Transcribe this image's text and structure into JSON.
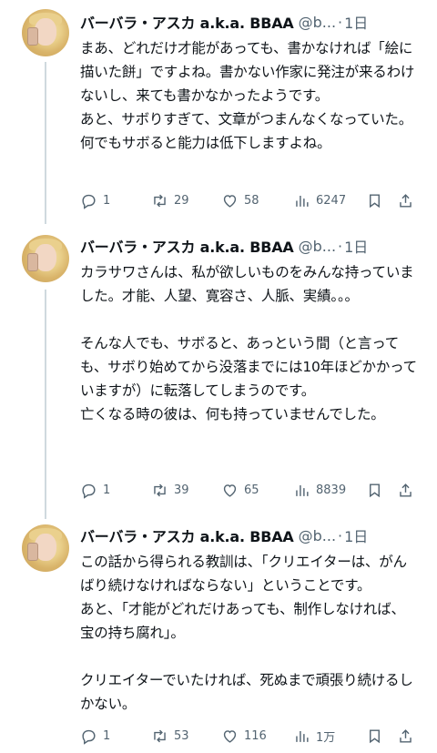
{
  "tweets": [
    {
      "name": "バーバラ・アスカ a.k.a. BBAA",
      "handle": "@b...",
      "separator": "·",
      "time": "1日",
      "text": "まあ、どれだけ才能があっても、書かなければ「絵に描いた餅」ですよね。書かない作家に発注が来るわけないし、来ても書かなかったようです。\nあと、サボりすぎて、文章がつまんなくなっていた。何でもサボると能力は低下しますよね。",
      "replies": "1",
      "retweets": "29",
      "likes": "58",
      "views": "6247"
    },
    {
      "name": "バーバラ・アスカ a.k.a. BBAA",
      "handle": "@b...",
      "separator": "·",
      "time": "1日",
      "text": "カラサワさんは、私が欲しいものをみんな持っていました。才能、人望、寛容さ、人脈、実績。。。\n\nそんな人でも、サボると、あっという間（と言っても、サボり始めてから没落までには10年ほどかかっていますが）に転落してしまうのです。\n亡くなる時の彼は、何も持っていませんでした。",
      "replies": "1",
      "retweets": "39",
      "likes": "65",
      "views": "8839"
    },
    {
      "name": "バーバラ・アスカ a.k.a. BBAA",
      "handle": "@b...",
      "separator": "·",
      "time": "1日",
      "text": "この話から得られる教訓は、「クリエイターは、がんばり続けなければならない」ということです。\nあと、「才能がどれだけあっても、制作しなければ、宝の持ち腐れ」。\n\nクリエイターでいたければ、死ぬまで頑張り続けるしかない。",
      "replies": "1",
      "retweets": "53",
      "likes": "116",
      "views": "1万"
    }
  ],
  "icons": [
    "reply-icon",
    "retweet-icon",
    "like-icon",
    "views-icon",
    "bookmark-icon",
    "share-icon"
  ],
  "colors": {
    "text": "#0f1419",
    "muted": "#536471",
    "thread_line": "#cfd9de"
  }
}
